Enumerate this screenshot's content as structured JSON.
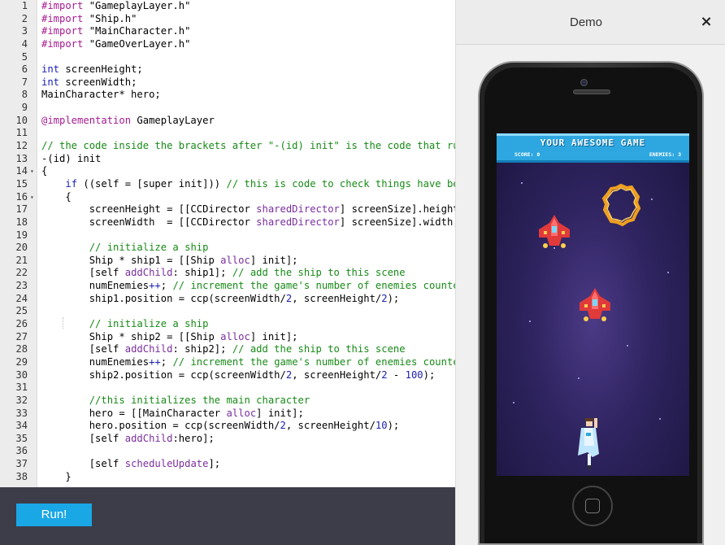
{
  "editor": {
    "lines": [
      {
        "n": "1",
        "fold": "",
        "tokens": [
          [
            "pp",
            "#import "
          ],
          [
            "str",
            "\"GameplayLayer.h\""
          ]
        ]
      },
      {
        "n": "2",
        "fold": "",
        "tokens": [
          [
            "pp",
            "#import "
          ],
          [
            "str",
            "\"Ship.h\""
          ]
        ]
      },
      {
        "n": "3",
        "fold": "",
        "tokens": [
          [
            "pp",
            "#import "
          ],
          [
            "str",
            "\"MainCharacter.h\""
          ]
        ]
      },
      {
        "n": "4",
        "fold": "",
        "tokens": [
          [
            "pp",
            "#import "
          ],
          [
            "str",
            "\"GameOverLayer.h\""
          ]
        ]
      },
      {
        "n": "5",
        "fold": "",
        "tokens": []
      },
      {
        "n": "6",
        "fold": "",
        "tokens": [
          [
            "kw",
            "int"
          ],
          [
            "",
            " screenHeight;"
          ]
        ]
      },
      {
        "n": "7",
        "fold": "",
        "tokens": [
          [
            "kw",
            "int"
          ],
          [
            "",
            " screenWidth;"
          ]
        ]
      },
      {
        "n": "8",
        "fold": "",
        "tokens": [
          [
            "",
            "MainCharacter* hero;"
          ]
        ]
      },
      {
        "n": "9",
        "fold": "",
        "tokens": []
      },
      {
        "n": "10",
        "fold": "",
        "tokens": [
          [
            "pp",
            "@implementation"
          ],
          [
            "",
            " GameplayLayer"
          ]
        ]
      },
      {
        "n": "11",
        "fold": "",
        "tokens": []
      },
      {
        "n": "12",
        "fold": "",
        "tokens": [
          [
            "cm",
            "// the code inside the brackets after \"-(id) init\" is the code that runs o"
          ]
        ]
      },
      {
        "n": "13",
        "fold": "",
        "tokens": [
          [
            "",
            "-(id) init"
          ]
        ]
      },
      {
        "n": "14",
        "fold": "▾",
        "tokens": [
          [
            "",
            "{"
          ]
        ]
      },
      {
        "n": "15",
        "fold": "",
        "tokens": [
          [
            "",
            "    "
          ],
          [
            "kw",
            "if"
          ],
          [
            "",
            " ((self = [super init])) "
          ],
          [
            "cm",
            "// this is code to check things have been i"
          ]
        ]
      },
      {
        "n": "16",
        "fold": "▾",
        "tokens": [
          [
            "",
            "    {"
          ]
        ]
      },
      {
        "n": "17",
        "fold": "",
        "tokens": [
          [
            "",
            "        screenHeight = [[CCDirector "
          ],
          [
            "it",
            "sharedDirector"
          ],
          [
            "",
            "] screenSize].height;"
          ]
        ]
      },
      {
        "n": "18",
        "fold": "",
        "tokens": [
          [
            "",
            "        screenWidth  = [[CCDirector "
          ],
          [
            "it",
            "sharedDirector"
          ],
          [
            "",
            "] screenSize].width;"
          ]
        ]
      },
      {
        "n": "19",
        "fold": "",
        "tokens": []
      },
      {
        "n": "20",
        "fold": "",
        "tokens": [
          [
            "",
            "        "
          ],
          [
            "cm",
            "// initialize a ship"
          ]
        ]
      },
      {
        "n": "21",
        "fold": "",
        "tokens": [
          [
            "",
            "        Ship * ship1 = [[Ship "
          ],
          [
            "it",
            "alloc"
          ],
          [
            "",
            "] init];"
          ]
        ]
      },
      {
        "n": "22",
        "fold": "",
        "tokens": [
          [
            "",
            "        [self "
          ],
          [
            "it",
            "addChild"
          ],
          [
            "",
            ": ship1]; "
          ],
          [
            "cm",
            "// add the ship to this scene"
          ]
        ]
      },
      {
        "n": "23",
        "fold": "",
        "tokens": [
          [
            "",
            "        numEnemies"
          ],
          [
            "kw",
            "++"
          ],
          [
            "",
            "; "
          ],
          [
            "cm",
            "// increment the game's number of enemies counter"
          ]
        ]
      },
      {
        "n": "24",
        "fold": "",
        "tokens": [
          [
            "",
            "        ship1.position = ccp(screenWidth/"
          ],
          [
            "num",
            "2"
          ],
          [
            "",
            ", screenHeight/"
          ],
          [
            "num",
            "2"
          ],
          [
            "",
            ");"
          ]
        ]
      },
      {
        "n": "25",
        "fold": "",
        "tokens": []
      },
      {
        "n": "26",
        "fold": "",
        "tokens": [
          [
            "",
            "        "
          ],
          [
            "cm",
            "// initialize a ship"
          ]
        ]
      },
      {
        "n": "27",
        "fold": "",
        "tokens": [
          [
            "",
            "        Ship * ship2 = [[Ship "
          ],
          [
            "it",
            "alloc"
          ],
          [
            "",
            "] init];"
          ]
        ]
      },
      {
        "n": "28",
        "fold": "",
        "tokens": [
          [
            "",
            "        [self "
          ],
          [
            "it",
            "addChild"
          ],
          [
            "",
            ": ship2]; "
          ],
          [
            "cm",
            "// add the ship to this scene"
          ]
        ]
      },
      {
        "n": "29",
        "fold": "",
        "tokens": [
          [
            "",
            "        numEnemies"
          ],
          [
            "kw",
            "++"
          ],
          [
            "",
            "; "
          ],
          [
            "cm",
            "// increment the game's number of enemies counter"
          ]
        ]
      },
      {
        "n": "30",
        "fold": "",
        "tokens": [
          [
            "",
            "        ship2.position = ccp(screenWidth/"
          ],
          [
            "num",
            "2"
          ],
          [
            "",
            ", screenHeight/"
          ],
          [
            "num",
            "2"
          ],
          [
            "",
            " - "
          ],
          [
            "num",
            "100"
          ],
          [
            "",
            ");"
          ]
        ]
      },
      {
        "n": "31",
        "fold": "",
        "tokens": []
      },
      {
        "n": "32",
        "fold": "",
        "tokens": [
          [
            "",
            "        "
          ],
          [
            "cm",
            "//this initializes the main character"
          ]
        ]
      },
      {
        "n": "33",
        "fold": "",
        "tokens": [
          [
            "",
            "        hero = [[MainCharacter "
          ],
          [
            "it",
            "alloc"
          ],
          [
            "",
            "] init];"
          ]
        ]
      },
      {
        "n": "34",
        "fold": "",
        "tokens": [
          [
            "",
            "        hero.position = ccp(screenWidth/"
          ],
          [
            "num",
            "2"
          ],
          [
            "",
            ", screenHeight/"
          ],
          [
            "num",
            "10"
          ],
          [
            "",
            ");"
          ]
        ]
      },
      {
        "n": "35",
        "fold": "",
        "tokens": [
          [
            "",
            "        [self "
          ],
          [
            "it",
            "addChild"
          ],
          [
            "",
            ":hero];"
          ]
        ]
      },
      {
        "n": "36",
        "fold": "",
        "tokens": []
      },
      {
        "n": "37",
        "fold": "",
        "tokens": [
          [
            "",
            "        [self "
          ],
          [
            "it",
            "scheduleUpdate"
          ],
          [
            "",
            "];"
          ]
        ]
      },
      {
        "n": "38",
        "fold": "",
        "tokens": [
          [
            "",
            "    }"
          ]
        ]
      }
    ]
  },
  "run_button": {
    "label": "Run!"
  },
  "demo": {
    "title": "Demo",
    "close_label": "×",
    "game": {
      "title": "YOUR AWESOME GAME",
      "score": "SCORE: 0",
      "enemies": "ENEMIES: 3"
    }
  },
  "colors": {
    "run_button": "#1aa7e6",
    "run_bar": "#3c3d49",
    "game_banner": "#2ea7e0"
  }
}
